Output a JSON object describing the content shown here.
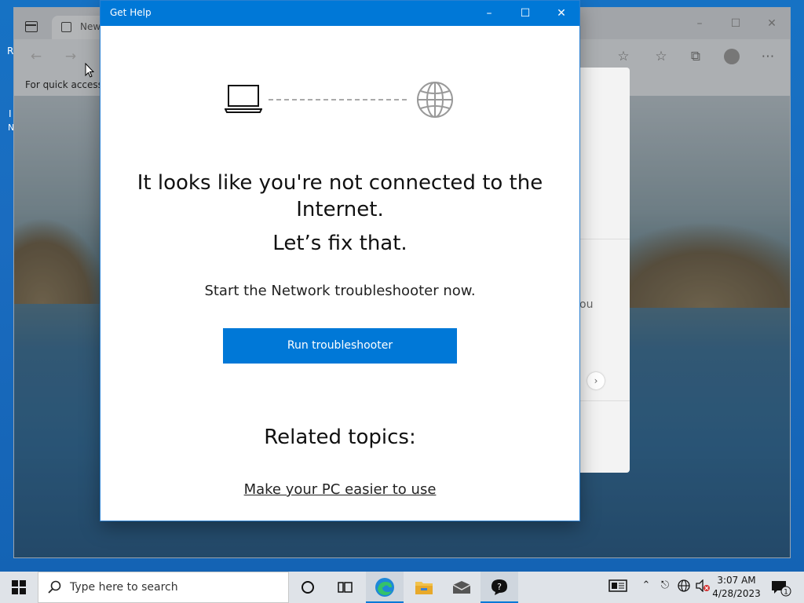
{
  "edge": {
    "tab_label": "New",
    "favbar_text": "For quick access, p",
    "ntp_partial_text": "ou"
  },
  "desktop": {
    "partial_icon_text_1": "R",
    "partial_icon_text_2": "I",
    "partial_icon_text_3": "N"
  },
  "gethelp": {
    "title": "Get Help",
    "heading_line1": "It looks like you're not connected to the",
    "heading_line2": "Internet.",
    "subheading": "Let’s fix that.",
    "prompt": "Start the Network troubleshooter now.",
    "run_button": "Run troubleshooter",
    "related_heading": "Related topics:",
    "related_link": "Make your PC easier to use"
  },
  "taskbar": {
    "search_placeholder": "Type here to search",
    "time": "3:07 AM",
    "date": "4/28/2023",
    "notification_count": "1"
  },
  "colors": {
    "accent": "#0078d7",
    "taskbar": "#dfe3e8"
  },
  "icons": {
    "start": "windows-logo-icon",
    "search": "search-icon",
    "cortana": "cortana-circle-icon",
    "task_view": "task-view-icon",
    "edge": "edge-icon",
    "file_explorer": "folder-icon",
    "mail": "mail-icon",
    "get_help": "get-help-icon"
  }
}
